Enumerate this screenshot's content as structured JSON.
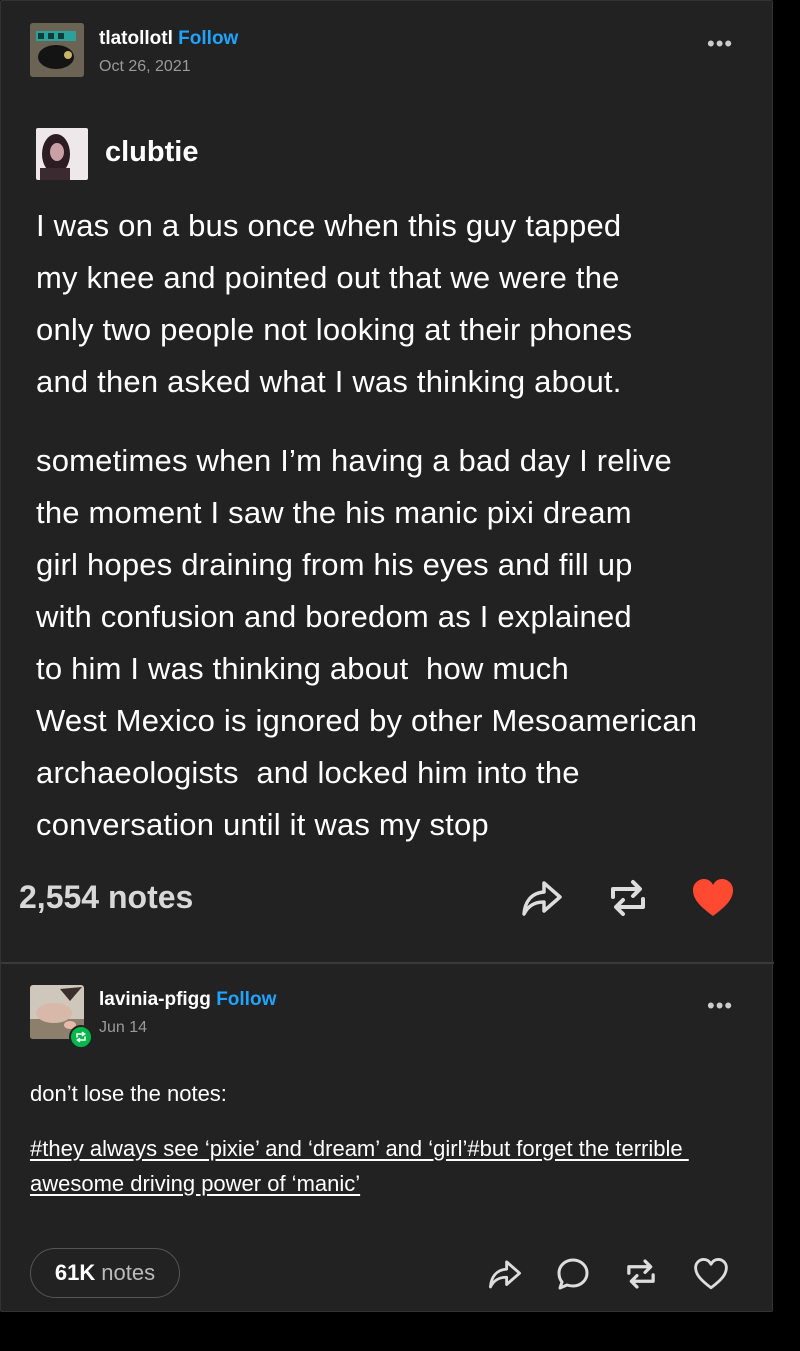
{
  "post1": {
    "username": "tlatollotl",
    "follow_label": "Follow",
    "date": "Oct 26, 2021",
    "more_label": "•••",
    "quoted_user": "clubtie",
    "paragraphs": [
      [
        "I was on a bus once when this guy tapped",
        "my knee and pointed out that we were the",
        "only two people not looking at their phones",
        "and then asked what I was thinking about."
      ],
      [
        "sometimes when I’m having a bad day I relive",
        "the moment I saw the his manic pixi dream",
        "girl hopes draining from his eyes and fill up",
        "with confusion and boredom as I explained",
        "to him I was thinking about  how much",
        "West Mexico is ignored by other Mesoamerican",
        "archaeologists  and locked him into the",
        "conversation until it was my stop"
      ]
    ],
    "notes": "2,554 notes",
    "like_color": "#ff4930"
  },
  "post2": {
    "username": "lavinia-pfigg",
    "follow_label": "Follow",
    "date": "Jun 14",
    "more_label": "•••",
    "body": "don’t lose the notes:",
    "tags_line1": "#they always see ‘pixie’ and ‘dream’ and ‘girl’#but forget the terrible ",
    "tags_line2": "awesome driving power of ‘manic’",
    "notes_count": "61K",
    "notes_label": "notes"
  },
  "colors": {
    "follow": "#1fa3ff",
    "background": "#222222",
    "reblog_badge": "#00b84a"
  }
}
